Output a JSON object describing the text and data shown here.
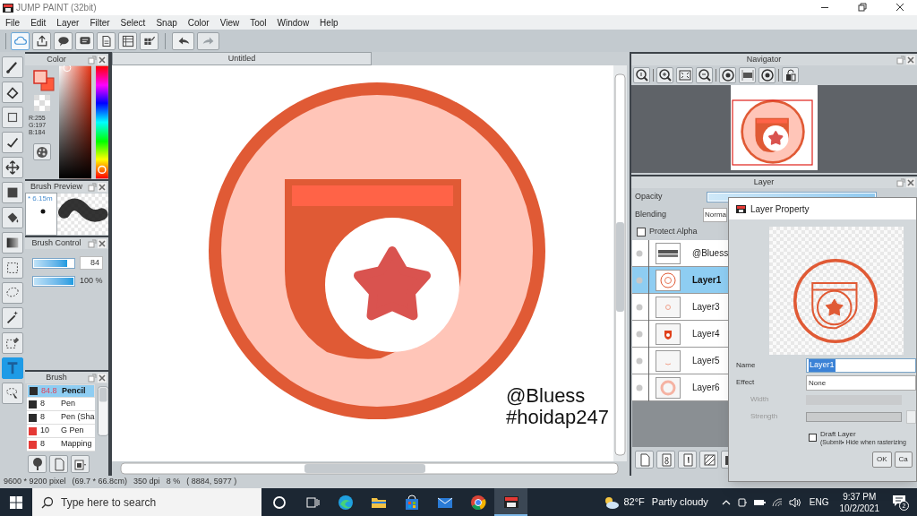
{
  "window": {
    "title": "JUMP PAINT (32bit)"
  },
  "menu": [
    "File",
    "Edit",
    "Layer",
    "Filter",
    "Select",
    "Snap",
    "Color",
    "View",
    "Tool",
    "Window",
    "Help"
  ],
  "tools": [
    {
      "kind": "brush",
      "selected": false
    },
    {
      "kind": "eraser",
      "selected": false
    },
    {
      "kind": "rect",
      "selected": false
    },
    {
      "kind": "line",
      "selected": false
    },
    {
      "kind": "move",
      "selected": false
    },
    {
      "kind": "fill",
      "selected": false
    },
    {
      "kind": "bucket",
      "selected": false
    },
    {
      "kind": "gradient",
      "selected": false
    },
    {
      "kind": "select",
      "selected": false
    },
    {
      "kind": "lasso",
      "selected": false
    },
    {
      "kind": "wand",
      "selected": false
    },
    {
      "kind": "select-eraser",
      "selected": false
    },
    {
      "kind": "text",
      "selected": true
    },
    {
      "kind": "select-pen",
      "selected": false
    }
  ],
  "color_panel": {
    "title": "Color",
    "rgb": [
      "R:255",
      "G:197",
      "B:184"
    ]
  },
  "brush_preview": {
    "title": "Brush Preview",
    "size": "* 6.15m"
  },
  "brush_control": {
    "title": "Brush Control",
    "sliders": [
      {
        "kind": "boxed",
        "level": 0.84,
        "reading": "84"
      },
      {
        "kind": "plain",
        "level": 1,
        "reading": "100 %"
      }
    ]
  },
  "brush": {
    "title": "Brush",
    "items": [
      {
        "color": "#2b2b2b",
        "size": "84.8",
        "name": "Pencil",
        "selected": true
      },
      {
        "color": "#2b2b2b",
        "size": "8",
        "name": "Pen",
        "selected": false
      },
      {
        "color": "#2b2b2b",
        "size": "8",
        "name": "Pen (Sha",
        "selected": false
      },
      {
        "color": "#e53935",
        "size": "10",
        "name": "G Pen",
        "selected": false
      },
      {
        "color": "#e53935",
        "size": "8",
        "name": "Mapping",
        "selected": false
      }
    ]
  },
  "canvas": {
    "tab": "Untitled",
    "caption": [
      "@Bluess",
      "#hoidap247"
    ]
  },
  "navigator": {
    "title": "Navigator"
  },
  "layer_panel": {
    "title": "Layer",
    "opacity_label": "Opacity",
    "opacity": {
      "level": 1
    },
    "blending_label": "Blending",
    "blending": "Norma",
    "protect_alpha": {
      "label": "Protect Alpha",
      "checked": false
    },
    "layers": [
      {
        "kind": "text",
        "name": "@Bluess",
        "selected": false
      },
      {
        "kind": "badge",
        "name": "Layer1",
        "selected": true
      },
      {
        "kind": "small",
        "name": "Layer3",
        "selected": false
      },
      {
        "kind": "shield",
        "name": "Layer4",
        "selected": false
      },
      {
        "kind": "faint",
        "name": "Layer5",
        "selected": false
      },
      {
        "kind": "ring",
        "name": "Layer6",
        "selected": false
      }
    ]
  },
  "dialog": {
    "title": "Layer Property",
    "fields": [
      {
        "kind": "text",
        "label": "Name",
        "value": "Layer1",
        "disabled": false
      },
      {
        "kind": "select",
        "label": "Effect",
        "value": "None",
        "disabled": false
      },
      {
        "kind": "bar",
        "label": "Width",
        "disabled": true
      },
      {
        "kind": "bar_box",
        "label": "Strength",
        "disabled": true
      }
    ],
    "draft": {
      "label": "Draft Layer",
      "note": "(Submit• Hide when rasterizing",
      "checked": false
    },
    "buttons": [
      "OK",
      "Ca"
    ]
  },
  "status_bar": [
    "9600 * 9200 pixel",
    "(69.7 * 66.8cm)",
    "350 dpi",
    "8 %",
    "( 8884, 5977 )"
  ],
  "taskbar": {
    "search_placeholder": "Type here to search",
    "temperature": "82°F",
    "weather": "Partly cloudy",
    "language": "ENG",
    "time": "9:37 PM",
    "date": "10/2/2021",
    "notifications": "2"
  }
}
